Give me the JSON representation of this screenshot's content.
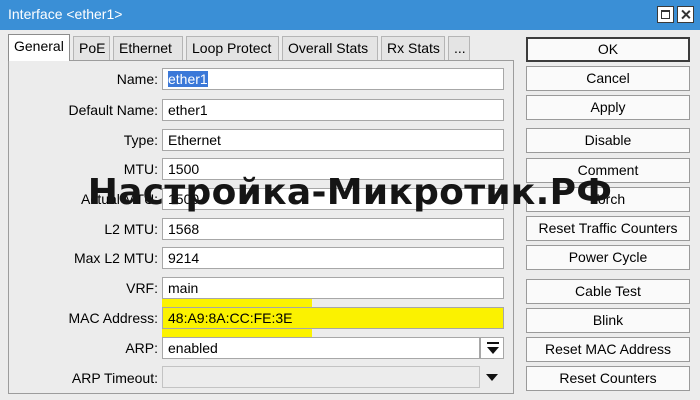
{
  "window": {
    "title": "Interface <ether1>"
  },
  "tabs": [
    {
      "label": "General",
      "active": true
    },
    {
      "label": "PoE"
    },
    {
      "label": "Ethernet"
    },
    {
      "label": "Loop Protect"
    },
    {
      "label": "Overall Stats"
    },
    {
      "label": "Rx Stats"
    },
    {
      "label": "..."
    }
  ],
  "fields": {
    "name": {
      "label": "Name:",
      "value": "ether1"
    },
    "default_name": {
      "label": "Default Name:",
      "value": "ether1"
    },
    "type": {
      "label": "Type:",
      "value": "Ethernet"
    },
    "mtu": {
      "label": "MTU:",
      "value": "1500"
    },
    "actual_mtu": {
      "label": "Actual MTU:",
      "value": "1500"
    },
    "l2_mtu": {
      "label": "L2 MTU:",
      "value": "1568"
    },
    "max_l2_mtu": {
      "label": "Max L2 MTU:",
      "value": "9214"
    },
    "vrf": {
      "label": "VRF:",
      "value": "main"
    },
    "mac_address": {
      "label": "MAC Address:",
      "value": "48:A9:8A:CC:FE:3E"
    },
    "arp": {
      "label": "ARP:",
      "value": "enabled"
    },
    "arp_timeout": {
      "label": "ARP Timeout:",
      "value": ""
    }
  },
  "buttons": {
    "ok": "OK",
    "cancel": "Cancel",
    "apply": "Apply",
    "disable": "Disable",
    "comment": "Comment",
    "torch": "Torch",
    "reset_traffic_counters": "Reset Traffic Counters",
    "power_cycle": "Power Cycle",
    "cable_test": "Cable Test",
    "blink": "Blink",
    "reset_mac_address": "Reset MAC Address",
    "reset_counters": "Reset Counters"
  },
  "watermark": "Настройка-Микротик.РФ",
  "colors": {
    "titlebar": "#3a8fd6",
    "highlight": "#fcf300",
    "selection": "#3b78d8"
  },
  "icons": {
    "maximize": "maximize-icon",
    "close": "close-icon",
    "dropdown": "dropdown-arrow-icon"
  }
}
